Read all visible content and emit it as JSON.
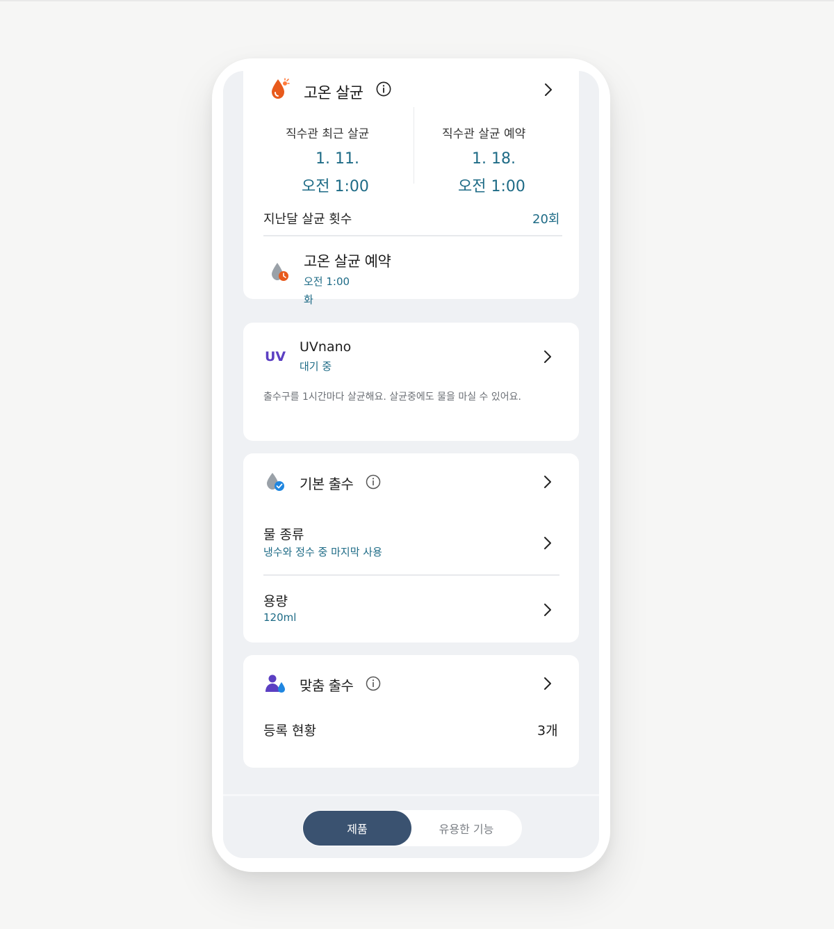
{
  "sterilize": {
    "title": "고온 살균",
    "recent_label": "직수관 최근 살균",
    "recent_date": "1. 11.",
    "recent_time": "오전 1:00",
    "reserve_label": "직수관 살균 예약",
    "reserve_date": "1. 18.",
    "reserve_time": "오전 1:00",
    "count_label": "지난달 살균 횟수",
    "count_value": "20회",
    "schedule_title": "고온 살균 예약",
    "schedule_time": "오전 1:00",
    "schedule_day": "화"
  },
  "uvnano": {
    "icon_text": "UV",
    "title": "UVnano",
    "status": "대기 중",
    "desc": "출수구를 1시간마다 살균해요. 살균중에도 물을 마실 수 있어요."
  },
  "basic_dispense": {
    "title": "기본 출수",
    "water_type_label": "물 종류",
    "water_type_value": "냉수와 정수 중 마지막 사용",
    "volume_label": "용량",
    "volume_value": "120ml"
  },
  "custom_dispense": {
    "title": "맞춤 출수",
    "registered_label": "등록 현황",
    "registered_value": "3개"
  },
  "bottom_tabs": {
    "product": "제품",
    "useful": "유용한 기능"
  },
  "colors": {
    "accent_teal": "#1e6b86",
    "tab_active": "#3a5270",
    "uv_purple": "#5b3fc2",
    "sterilize_orange": "#e85a1c"
  }
}
